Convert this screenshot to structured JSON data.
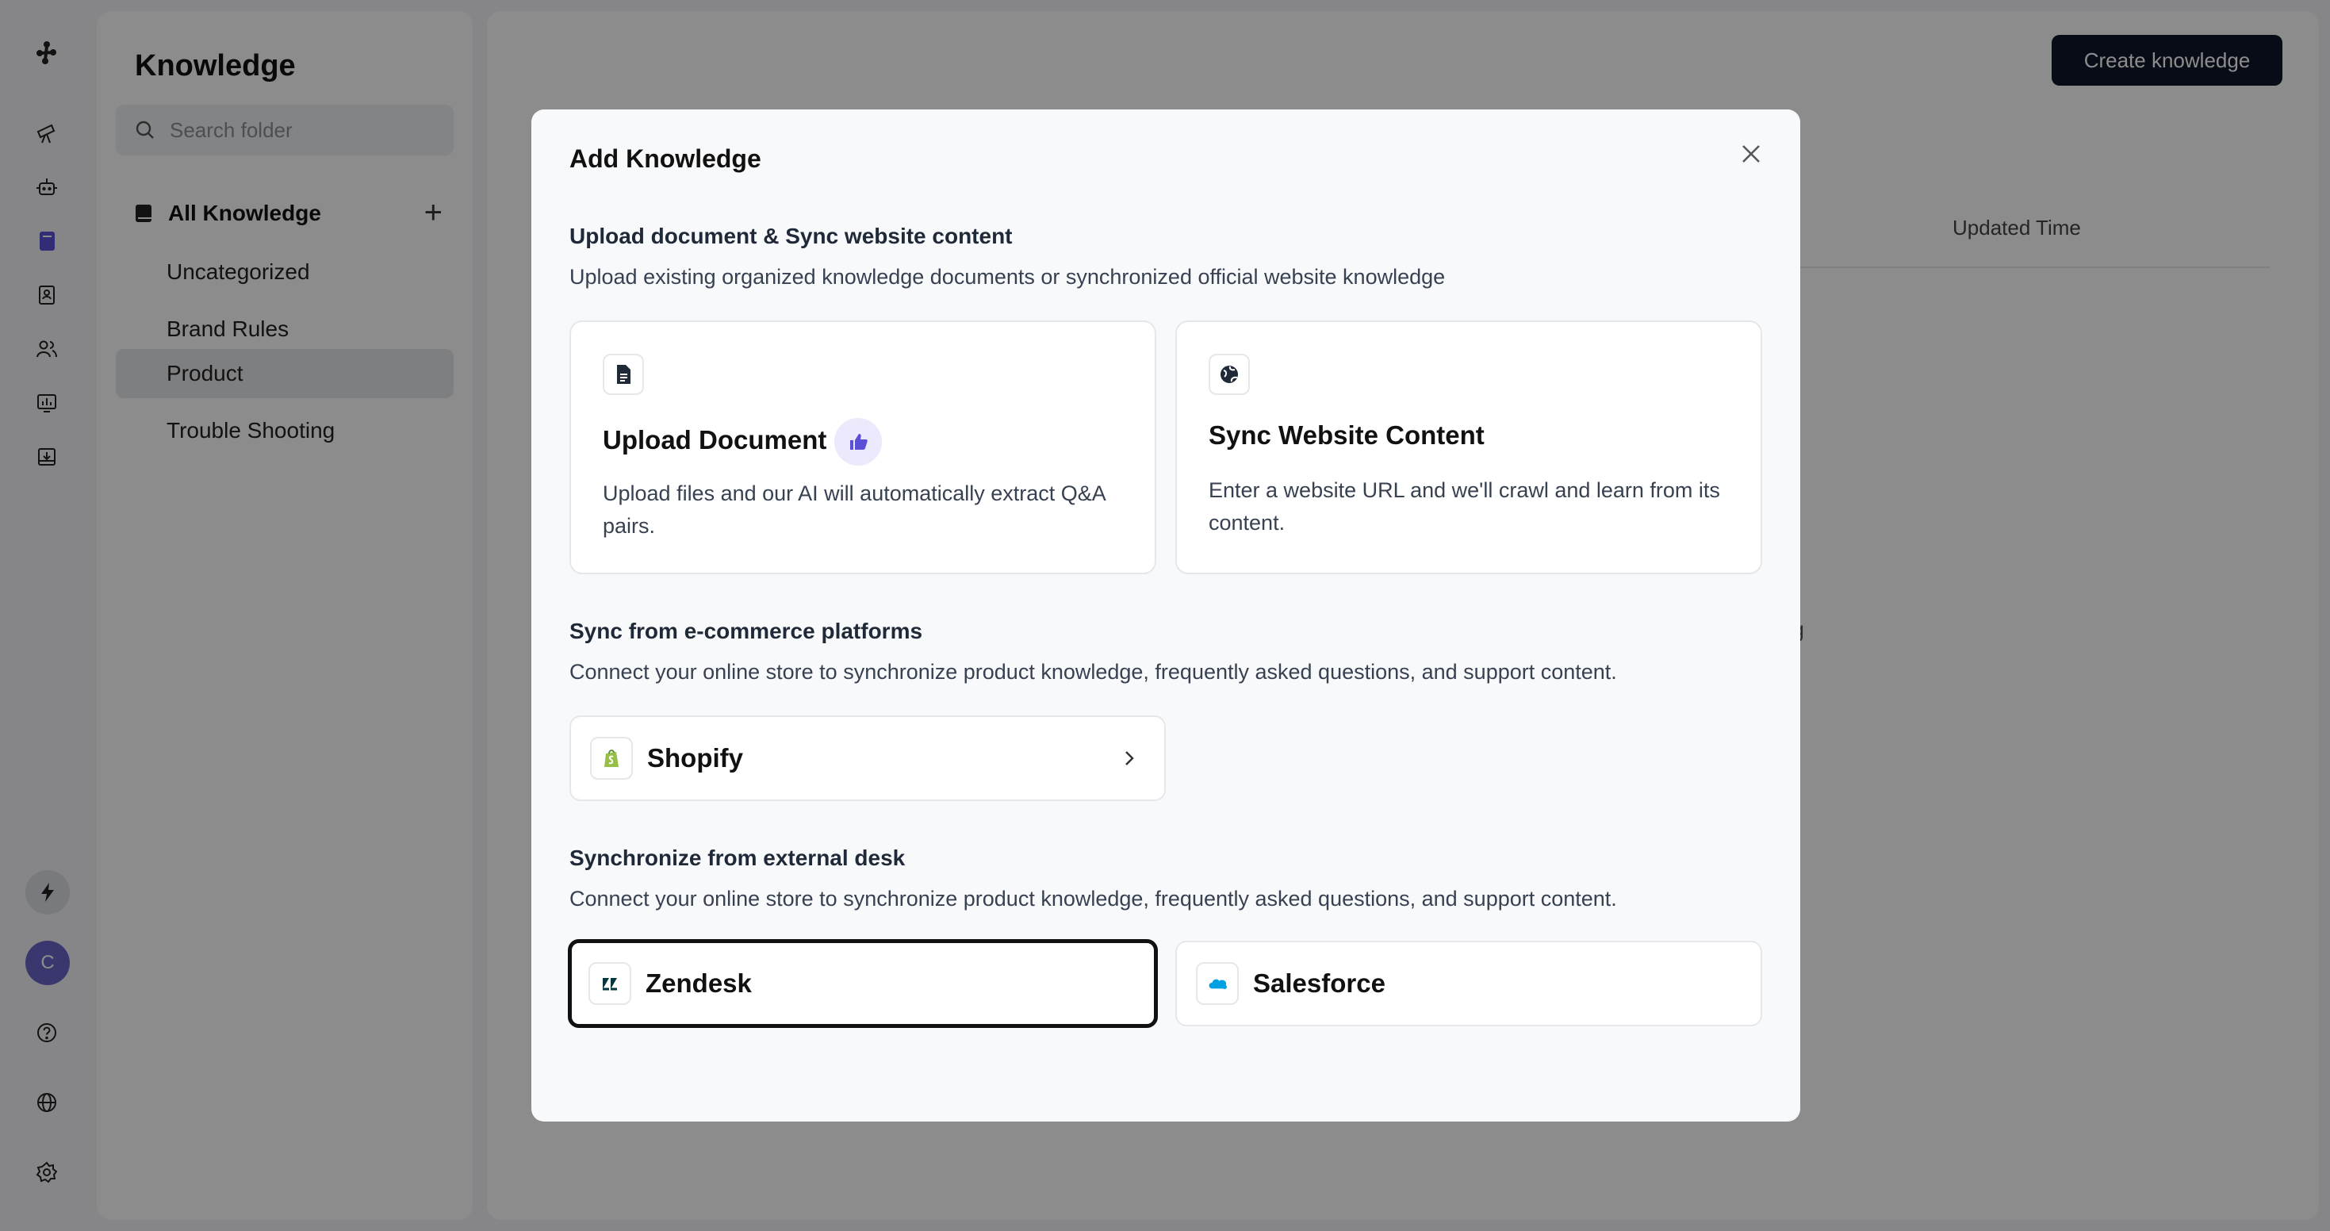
{
  "sidebar": {
    "title": "Knowledge",
    "search_placeholder": "Search folder",
    "all_label": "All Knowledge",
    "add_symbol": "+",
    "folders": [
      "Uncategorized",
      "Brand Rules",
      "Product",
      "Trouble Shooting"
    ],
    "active_folder": "Product"
  },
  "rail": {
    "avatar_letter": "C"
  },
  "main": {
    "create_button": "Create knowledge",
    "column_header": "Updated Time",
    "background_fragment": "ding"
  },
  "modal": {
    "title": "Add Knowledge",
    "section1": {
      "title": "Upload document & Sync website content",
      "desc": "Upload existing organized knowledge documents or synchronized official website knowledge",
      "upload": {
        "title": "Upload Document",
        "desc": "Upload files and our AI will automatically extract Q&A pairs."
      },
      "website": {
        "title": "Sync Website Content",
        "desc": "Enter a website URL and we'll crawl and learn from its content."
      }
    },
    "section2": {
      "title": "Sync from e-commerce platforms",
      "desc": "Connect your online store to synchronize product knowledge, frequently asked questions, and support content.",
      "shopify": "Shopify"
    },
    "section3": {
      "title": "Synchronize from external desk",
      "desc": "Connect your online store to synchronize product knowledge, frequently asked questions, and support content.",
      "zendesk": "Zendesk",
      "salesforce": "Salesforce"
    }
  },
  "colors": {
    "accent": "#5b4fd6",
    "dark_button": "#0f172a",
    "shopify_green": "#95bf47",
    "salesforce_blue": "#00a1e0"
  }
}
